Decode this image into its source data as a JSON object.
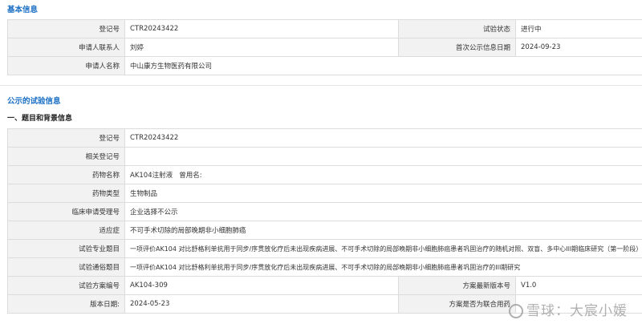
{
  "basic_info": {
    "title": "基本信息",
    "reg_no_label": "登记号",
    "reg_no": "CTR20243422",
    "status_label": "试验状态",
    "status": "进行中",
    "contact_label": "申请人联系人",
    "contact": "刘婷",
    "first_pub_label": "首次公示信息日期",
    "first_pub": "2024-09-23",
    "applicant_label": "申请人名称",
    "applicant": "中山康方生物医药有限公司"
  },
  "trial_info": {
    "title": "公示的试验信息",
    "subtitle": "一、题目和背景信息",
    "reg_no_label": "登记号",
    "reg_no": "CTR20243422",
    "related_label": "相关登记号",
    "related": "",
    "drug_name_label": "药物名称",
    "drug_name": "AK104注射液   曾用名:",
    "drug_type_label": "药物类型",
    "drug_type": "生物制品",
    "clinical_no_label": "临床申请受理号",
    "clinical_no": "企业选择不公示",
    "indication_label": "适应症",
    "indication": "不可手术切除的局部晚期非小细胞肺癌",
    "pro_title_label": "试验专业题目",
    "pro_title": "一项评价AK104 对比舒格利单抗用于同步/序贯放化疗后未出现疾病进展、不可手术切除的局部晚期非小细胞肺癌患者巩固治疗的随机对照、双盲、多中心III期临床研究（第一阶段）",
    "pop_title_label": "试验通俗题目",
    "pop_title": "一项评价AK104 对比舒格利单抗用于同步/序贯放化疗后未出现疾病进展、不可手术切除的局部晚期非小细胞肺癌患者巩固治疗的III期研究",
    "protocol_no_label": "试验方案编号",
    "protocol_no": "AK104-309",
    "latest_ver_label": "方案最新版本号",
    "latest_ver": "V1.0",
    "version_date_label": "版本日期:",
    "version_date": "2024-05-23",
    "blind_label": "方案是否为联合用药",
    "blind": ""
  },
  "watermark": {
    "text": "雪球：大宸小媛"
  }
}
